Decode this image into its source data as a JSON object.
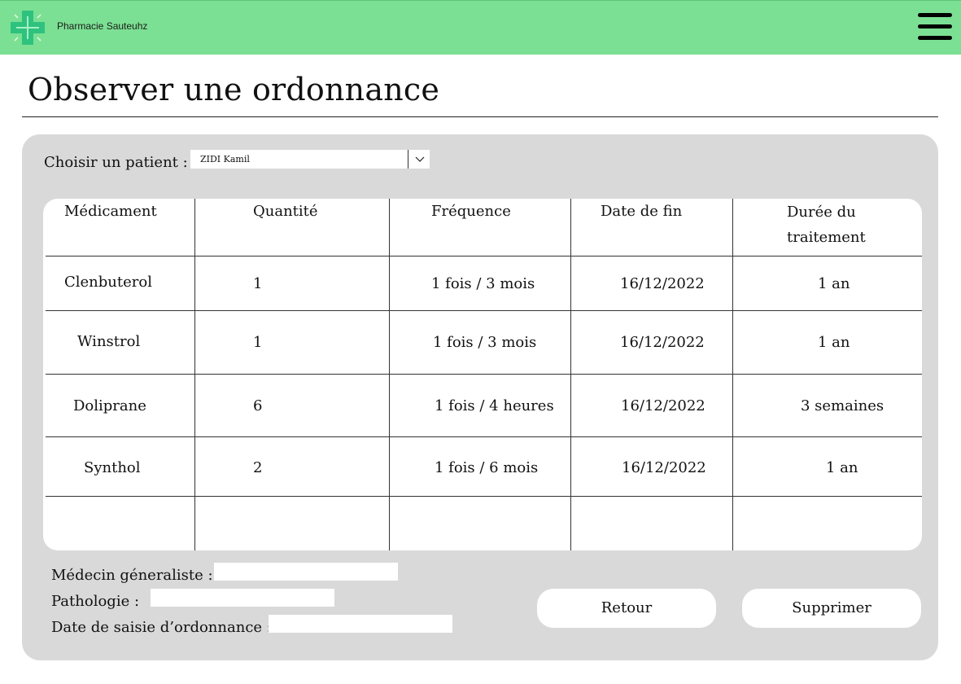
{
  "app": {
    "brand_name": "Pharmacie Sauteuhz",
    "logo_icon": "pharmacy-cross-icon",
    "menu_icon": "hamburger-menu-icon",
    "header_color": "#7be093"
  },
  "page": {
    "title": "Observer une ordonnance"
  },
  "patient": {
    "label": "Choisir un patient :",
    "selected": "ZIDI Kamil",
    "chevron_icon": "chevron-down-icon"
  },
  "table": {
    "headers": [
      "Médicament",
      "Quantité",
      "Fréquence",
      "Date de fin",
      "Durée du traitement"
    ],
    "rows": [
      [
        "Clenbuterol",
        "1",
        "1 fois / 3 mois",
        "16/12/2022",
        "1 an"
      ],
      [
        "Winstrol",
        "1",
        "1 fois / 3 mois",
        "16/12/2022",
        "1 an"
      ],
      [
        "Doliprane",
        "6",
        "1 fois / 4 heures",
        "16/12/2022",
        "3 semaines"
      ],
      [
        "Synthol",
        "2",
        "1 fois / 6 mois",
        "16/12/2022",
        "1 an"
      ],
      [
        "",
        "",
        "",
        "",
        ""
      ]
    ]
  },
  "info": {
    "doctor_label": "Médecin géneraliste :",
    "doctor_value": "",
    "pathology_label": "Pathologie :",
    "pathology_value": "",
    "date_label": "Date de saisie d’ordonnance :",
    "date_value": ""
  },
  "actions": {
    "back_label": "Retour",
    "delete_label": "Supprimer"
  }
}
